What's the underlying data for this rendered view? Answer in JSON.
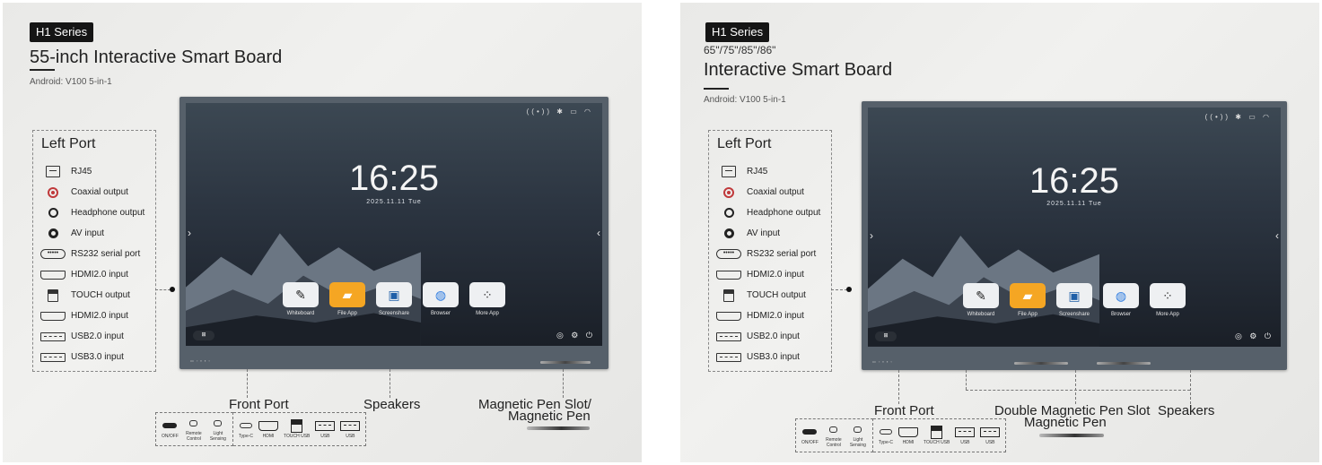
{
  "panels": [
    {
      "series": "H1 Series",
      "sizes": "",
      "title": "55-inch Interactive Smart Board",
      "android": "Android: V100 5-in-1",
      "left_port_title": "Left Port",
      "left_ports": [
        {
          "icon": "rj45-icon",
          "label": "RJ45"
        },
        {
          "icon": "coaxial-icon",
          "label": "Coaxial output"
        },
        {
          "icon": "headphone-icon",
          "label": "Headphone output"
        },
        {
          "icon": "av-icon",
          "label": "AV input"
        },
        {
          "icon": "rs232-icon",
          "label": "RS232 serial port"
        },
        {
          "icon": "hdmi-icon",
          "label": "HDMI2.0 input"
        },
        {
          "icon": "touch-icon",
          "label": "TOUCH output"
        },
        {
          "icon": "hdmi-icon",
          "label": "HDMI2.0 input"
        },
        {
          "icon": "usb-icon",
          "label": "USB2.0 input"
        },
        {
          "icon": "usb-icon",
          "label": "USB3.0 input"
        }
      ],
      "screen": {
        "time": "16:25",
        "date": "2025.11.11   Tue",
        "apps": [
          {
            "label": "Whiteboard",
            "icon": "pen-icon"
          },
          {
            "label": "File App",
            "icon": "folder-icon"
          },
          {
            "label": "Screenshare",
            "icon": "screenshare-icon"
          },
          {
            "label": "Browser",
            "icon": "browser-icon"
          },
          {
            "label": "More App",
            "icon": "grid-icon"
          }
        ]
      },
      "callouts": {
        "front_port": "Front Port",
        "speakers": "Speakers",
        "pen_line1": "Magnetic Pen Slot/",
        "pen_line2": "Magnetic Pen"
      },
      "front_ports": {
        "group1": [
          {
            "icon": "power-icon",
            "label": "ON/OFF"
          },
          {
            "icon": "remote-sensor-icon",
            "label": "Remote Control"
          },
          {
            "icon": "light-sensor-icon",
            "label": "Light Sensing"
          }
        ],
        "group2": [
          {
            "icon": "type-c-icon",
            "label": "Type-C"
          },
          {
            "icon": "hdmi-icon",
            "label": "HDMI"
          },
          {
            "icon": "touch-usb-icon",
            "label": "TOUCH USB"
          },
          {
            "icon": "usb-icon",
            "label": "USB"
          },
          {
            "icon": "usb-icon",
            "label": "USB"
          }
        ]
      }
    },
    {
      "series": "H1 Series",
      "sizes": "65\"/75\"/85\"/86\"",
      "title": "Interactive Smart Board",
      "android": "Android: V100 5-in-1",
      "left_port_title": "Left Port",
      "left_ports": [
        {
          "icon": "rj45-icon",
          "label": "RJ45"
        },
        {
          "icon": "coaxial-icon",
          "label": "Coaxial output"
        },
        {
          "icon": "headphone-icon",
          "label": "Headphone output"
        },
        {
          "icon": "av-icon",
          "label": "AV input"
        },
        {
          "icon": "rs232-icon",
          "label": "RS232 serial port"
        },
        {
          "icon": "hdmi-icon",
          "label": "HDMI2.0 input"
        },
        {
          "icon": "touch-icon",
          "label": "TOUCH output"
        },
        {
          "icon": "hdmi-icon",
          "label": "HDMI2.0 input"
        },
        {
          "icon": "usb-icon",
          "label": "USB2.0 input"
        },
        {
          "icon": "usb-icon",
          "label": "USB3.0 input"
        }
      ],
      "screen": {
        "time": "16:25",
        "date": "2025.11.11   Tue",
        "apps": [
          {
            "label": "Whiteboard",
            "icon": "pen-icon"
          },
          {
            "label": "File App",
            "icon": "folder-icon"
          },
          {
            "label": "Screenshare",
            "icon": "screenshare-icon"
          },
          {
            "label": "Browser",
            "icon": "browser-icon"
          },
          {
            "label": "More App",
            "icon": "grid-icon"
          }
        ]
      },
      "callouts": {
        "front_port": "Front Port",
        "pen_line1": "Double Magnetic Pen Slot",
        "pen_line2": "Magnetic Pen",
        "speakers": "Speakers"
      },
      "front_ports": {
        "group1": [
          {
            "icon": "power-icon",
            "label": "ON/OFF"
          },
          {
            "icon": "remote-sensor-icon",
            "label": "Remote Control"
          },
          {
            "icon": "light-sensor-icon",
            "label": "Light Sensing"
          }
        ],
        "group2": [
          {
            "icon": "type-c-icon",
            "label": "Type-C"
          },
          {
            "icon": "hdmi-icon",
            "label": "HDMI"
          },
          {
            "icon": "touch-usb-icon",
            "label": "TOUCH USB"
          },
          {
            "icon": "usb-icon",
            "label": "USB"
          },
          {
            "icon": "usb-icon",
            "label": "USB"
          }
        ]
      }
    }
  ]
}
